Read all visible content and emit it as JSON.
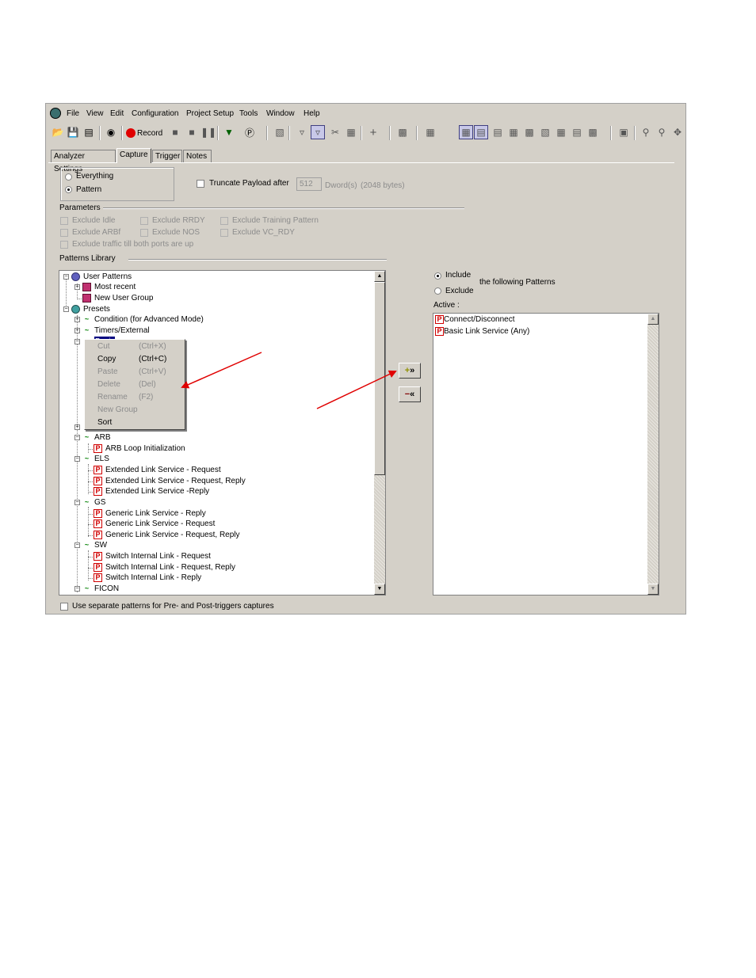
{
  "menu": [
    "File",
    "View",
    "Edit",
    "Configuration",
    "Project Setup",
    "Tools",
    "Window",
    "Help"
  ],
  "toolbar": {
    "record_label": "Record",
    "icons": [
      "open-icon",
      "save-icon",
      "report-icon",
      "analyzer-icon",
      "record-icon",
      "stop-icon",
      "pause-icon",
      "trigger-icon",
      "pattern-icon",
      "find-icon",
      "filter-icon",
      "filter-hide-icon",
      "cut-icon",
      "copy-icon",
      "add-icon",
      "zoom-icon",
      "layout-icon",
      "grid-icon",
      "view-icon"
    ]
  },
  "tabs": [
    "Analyzer Settings",
    "Capture",
    "Trigger",
    "Notes"
  ],
  "capture_mode": {
    "options": [
      "Everything",
      "Pattern"
    ],
    "selected": "Pattern"
  },
  "truncate": {
    "label": "Truncate Payload after",
    "value": "512",
    "unit": "Dword(s)",
    "bytes": "(2048 bytes)"
  },
  "parameters": {
    "title": "Parameters",
    "options": [
      "Exclude Idle",
      "Exclude RRDY",
      "Exclude Training Pattern",
      "Exclude ARBf",
      "Exclude NOS",
      "Exclude VC_RDY",
      "Exclude traffic till both ports are up"
    ]
  },
  "library": {
    "title": "Patterns Library",
    "tree": [
      "User Patterns",
      "Most recent",
      "New User Group",
      "Presets",
      "Condition (for Advanced Mode)",
      "Timers/External",
      "Basic",
      "ARB",
      "ARB Loop Initialization",
      "ELS",
      "Extended Link Service - Request",
      "Extended Link Service - Request, Reply",
      "Extended Link Service -Reply",
      "GS",
      "Generic Link Service - Reply",
      "Generic Link Service - Request",
      "Generic Link Service - Request, Reply",
      "SW",
      "Switch Internal Link - Request",
      "Switch Internal Link - Request, Reply",
      "Switch Internal Link - Reply",
      "FICON"
    ]
  },
  "context_menu": [
    {
      "label": "Cut",
      "shortcut": "(Ctrl+X)",
      "enabled": false
    },
    {
      "label": "Copy",
      "shortcut": "(Ctrl+C)",
      "enabled": true
    },
    {
      "label": "Paste",
      "shortcut": "(Ctrl+V)",
      "enabled": false
    },
    {
      "label": "Delete",
      "shortcut": "(Del)",
      "enabled": false
    },
    {
      "label": "Rename",
      "shortcut": "(F2)",
      "enabled": false
    },
    {
      "label": "New Group",
      "shortcut": "",
      "enabled": false
    },
    {
      "label": "Sort",
      "shortcut": "",
      "enabled": true
    }
  ],
  "filter": {
    "include_label": "Include",
    "exclude_label": "Exclude",
    "following_label": "the following Patterns",
    "selected": "Include",
    "active_label": "Active :",
    "active_items": [
      "Connect/Disconnect",
      "Basic Link Service (Any)"
    ]
  },
  "buttons": {
    "add": "+»",
    "remove": "−«"
  },
  "separate_patterns_label": "Use separate patterns for Pre- and Post-triggers captures",
  "colors": {
    "window": "#d4d0c8",
    "arrow": "#e00000",
    "pattern_icon": "#d00000",
    "signal_icon": "#008000"
  }
}
